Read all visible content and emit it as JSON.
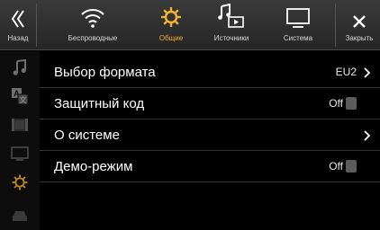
{
  "topbar": {
    "tabs": [
      {
        "label": "Назад",
        "icon": "back-icon"
      },
      {
        "label": "Беспроводные",
        "icon": "wifi-icon"
      },
      {
        "label": "Общие",
        "icon": "gear-icon",
        "active": true
      },
      {
        "label": "Источники",
        "icon": "music-screen-icon"
      },
      {
        "label": "Система",
        "icon": "monitor-icon"
      },
      {
        "label": "Закрыть",
        "icon": "close-icon"
      }
    ],
    "accent_color": "#f2b233"
  },
  "sidebar": {
    "items": [
      {
        "icon": "music-note-icon"
      },
      {
        "icon": "language-icon"
      },
      {
        "icon": "film-icon"
      },
      {
        "icon": "display-icon"
      },
      {
        "icon": "gear-icon",
        "active": true
      },
      {
        "icon": "car-icon"
      }
    ]
  },
  "settings": {
    "rows": [
      {
        "title": "Выбор формата",
        "value": "EU2",
        "type": "link"
      },
      {
        "title": "Защитный код",
        "value": "Off",
        "type": "toggle",
        "enabled": false
      },
      {
        "title": "О системе",
        "value": "",
        "type": "link"
      },
      {
        "title": "Демо-режим",
        "value": "Off",
        "type": "toggle",
        "enabled": false
      }
    ]
  }
}
